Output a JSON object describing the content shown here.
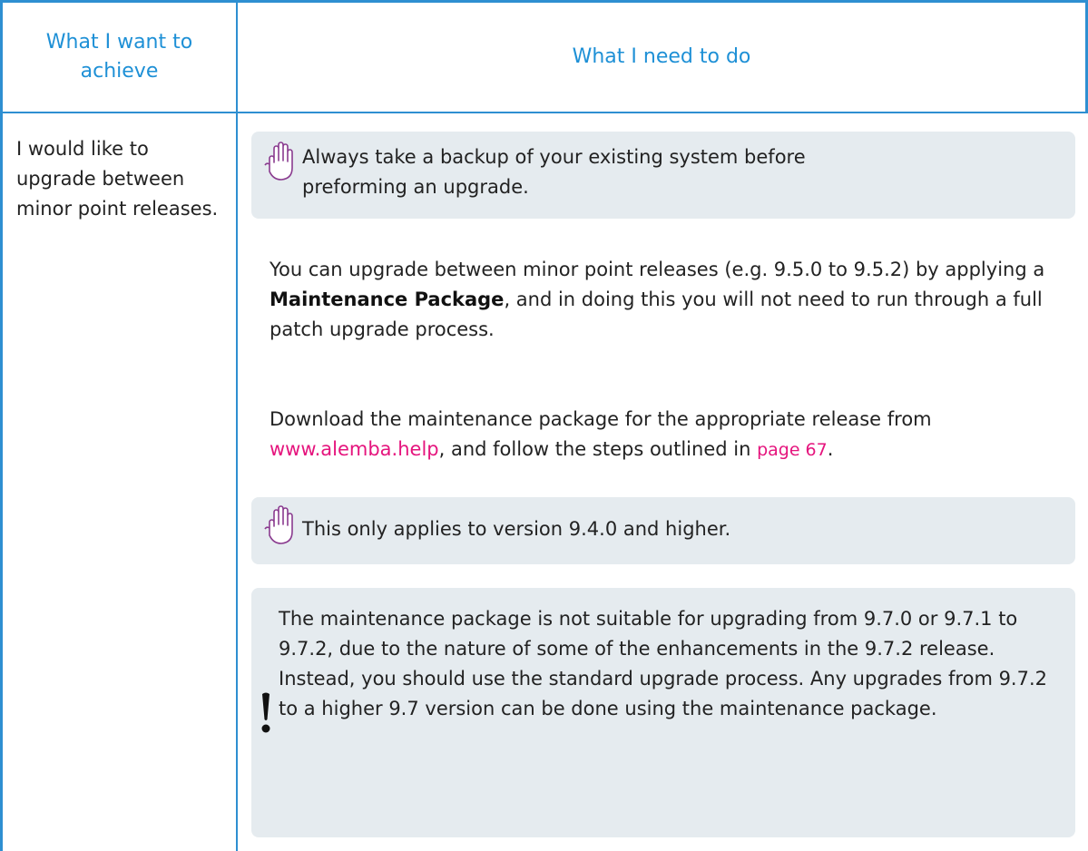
{
  "table": {
    "header": {
      "col1": "What I want to achieve",
      "col2": "What I need to do"
    },
    "row": {
      "goal": "I would like to upgrade between minor point releases.",
      "note_backup": "Always take a backup of your existing system before preforming an upgrade.",
      "para1": {
        "before": "You can upgrade between minor point releases (e.g. 9.5.0 to 9.5.2) by applying a ",
        "bold": "Maintenance Package",
        "after": ", and in doing this you will not need to run through a full patch upgrade process."
      },
      "para2": {
        "before": "Download the maintenance package for the appropriate release from ",
        "link": "www.alemba.help",
        "middle": ", and follow the steps outlined in ",
        "page_link": "page 67",
        "after": "."
      },
      "note_version": "This only applies to version 9.4.0 and higher.",
      "warning": "The maintenance package is not suitable for upgrading from 9.7.0 or 9.7.1 to 9.7.2, due to the nature of some of the enhancements in the 9.7.2 release. Instead, you should use the standard upgrade process. Any upgrades from 9.7.2 to a higher 9.7 version can be done using the maintenance package."
    }
  },
  "icons": {
    "note": "hand-stop-icon",
    "warning": "exclamation-icon"
  },
  "colors": {
    "border": "#2e8fd1",
    "header_text": "#1e90d6",
    "note_bg": "#e5ebef",
    "link": "#e5147d"
  }
}
